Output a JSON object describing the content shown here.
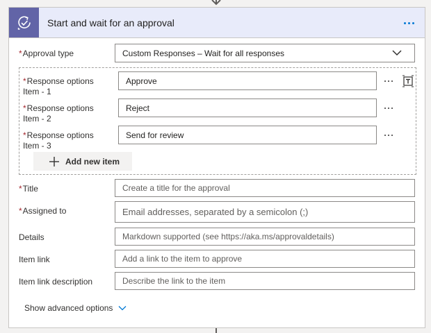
{
  "card": {
    "title": "Start and wait for an approval",
    "icon": "approval-icon",
    "accent_color": "#6264a7"
  },
  "approval_type": {
    "label": "Approval type",
    "value": "Custom Responses – Wait for all responses"
  },
  "response_options": {
    "items": [
      {
        "label_line1": "Response options",
        "label_line2": "Item - 1",
        "value": "Approve"
      },
      {
        "label_line1": "Response options",
        "label_line2": "Item - 2",
        "value": "Reject"
      },
      {
        "label_line1": "Response options",
        "label_line2": "Item - 3",
        "value": "Send for review"
      }
    ],
    "add_label": "Add new item"
  },
  "fields": {
    "title": {
      "label": "Title",
      "placeholder": "Create a title for the approval"
    },
    "assigned_to": {
      "label": "Assigned to",
      "placeholder": "Email addresses, separated by a semicolon (;)"
    },
    "details": {
      "label": "Details",
      "placeholder": "Markdown supported (see https://aka.ms/approvaldetails)"
    },
    "item_link": {
      "label": "Item link",
      "placeholder": "Add a link to the item to approve"
    },
    "item_link_description": {
      "label": "Item link description",
      "placeholder": "Describe the link to the item"
    }
  },
  "advanced": {
    "label": "Show advanced options"
  }
}
